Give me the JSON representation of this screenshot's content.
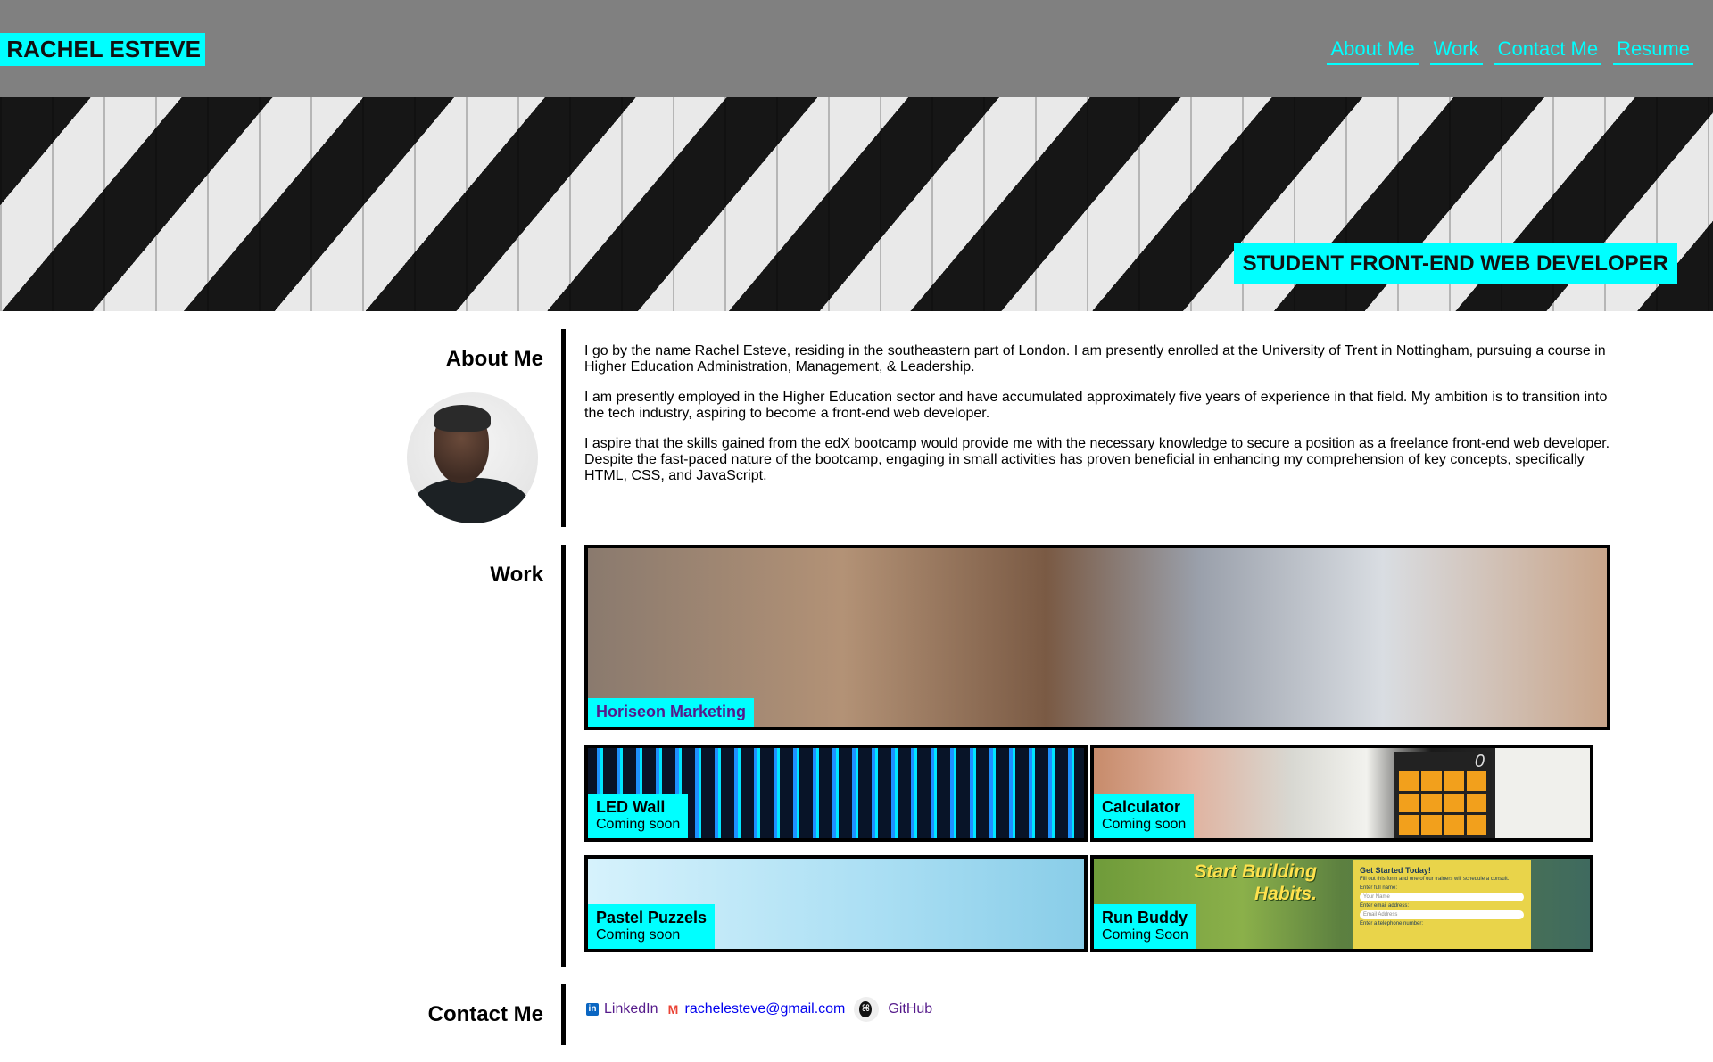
{
  "header": {
    "logo": "RACHEL ESTEVE",
    "nav": [
      "About Me",
      "Work",
      "Contact Me",
      "Resume"
    ],
    "colors": {
      "bar": "#808080",
      "accent": "#00ffff"
    }
  },
  "hero": {
    "title": "STUDENT FRONT-END WEB DEVELOPER"
  },
  "about": {
    "heading": "About Me",
    "paragraphs": [
      "I go by the name Rachel Esteve, residing in the southeastern part of London. I am presently enrolled at the University of Trent in Nottingham, pursuing a course in Higher Education Administration, Management, & Leadership.",
      "I am presently employed in the Higher Education sector and have accumulated approximately five years of experience in that field. My ambition is to transition into the tech industry, aspiring to become a front-end web developer.",
      "I aspire that the skills gained from the edX bootcamp would provide me with the necessary knowledge to secure a position as a freelance front-end web developer. Despite the fast-paced nature of the bootcamp, engaging in small activities has proven beneficial in enhancing my comprehension of key concepts, specifically HTML, CSS, and JavaScript."
    ]
  },
  "work": {
    "heading": "Work",
    "projects": [
      {
        "title": "Horiseon Marketing",
        "status": ""
      },
      {
        "title": "LED Wall",
        "status": "Coming soon"
      },
      {
        "title": "Calculator",
        "status": "Coming soon"
      },
      {
        "title": "Pastel Puzzels",
        "status": "Coming soon"
      },
      {
        "title": "Run Buddy",
        "status": "Coming Soon"
      }
    ],
    "run_buddy_preview": {
      "headline": "Start Building Habits.",
      "form_title": "Get Started Today!",
      "form_note": "Fill out this form and one of our trainers will schedule a consult.",
      "name_label": "Enter full name:",
      "name_placeholder": "Your Name",
      "email_label": "Enter email address:",
      "email_placeholder": "Email Address",
      "phone_label": "Enter a telephone number:"
    },
    "calculator_display": "0"
  },
  "contact": {
    "heading": "Contact Me",
    "linkedin": "LinkedIn",
    "email": "rachelesteve@gmail.com",
    "github": "GitHub"
  }
}
